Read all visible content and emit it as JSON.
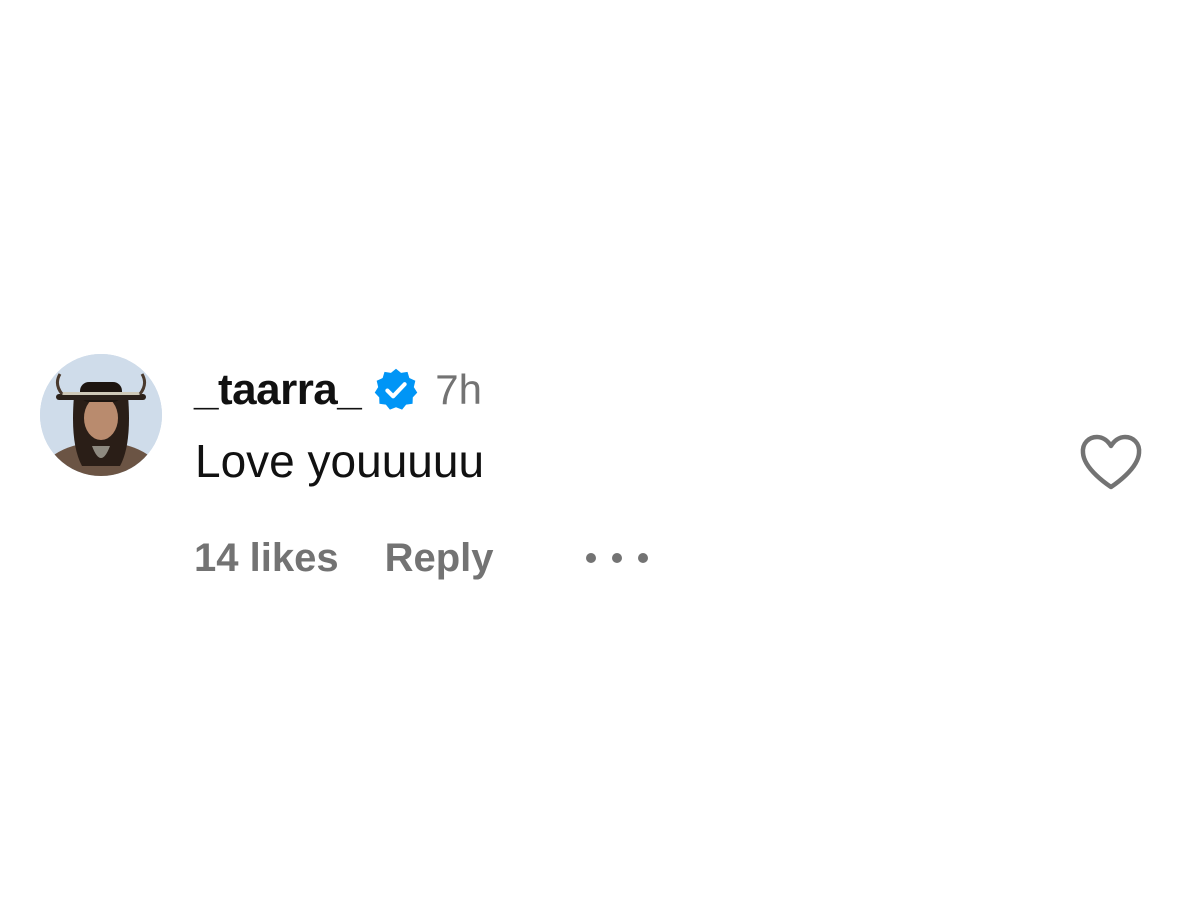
{
  "comment": {
    "username": "_taarra_",
    "verified": true,
    "timestamp": "7h",
    "text": "Love youuuuu",
    "likes_label": "14 likes",
    "reply_label": "Reply"
  },
  "icons": {
    "verified": "verified-badge-icon",
    "like": "heart-icon",
    "more": "more-options-icon"
  },
  "colors": {
    "verified_blue": "#0095f6",
    "secondary_text": "#737373",
    "primary_text": "#111111"
  }
}
